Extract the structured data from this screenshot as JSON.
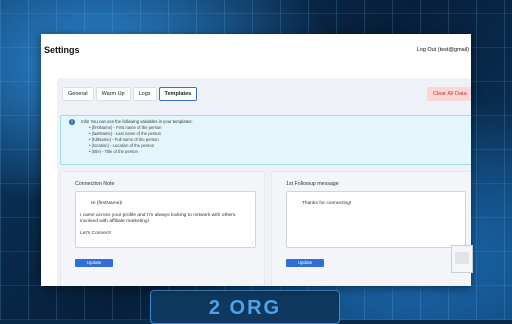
{
  "page": {
    "title": "Settings",
    "logout": "Log Out (test@gmail)"
  },
  "tabs": [
    "General",
    "Warm Up",
    "Logs",
    "Templates"
  ],
  "active_tab": "Templates",
  "clear_button": "Clear All Data",
  "info": {
    "icon": "info-icon",
    "title": "Info! You can use the following variables in your templates:",
    "items": [
      "{firstName} - First name of the person",
      "{lastName} - Last name of the person",
      "{fullName} - Full name of the person",
      "{location} - Location of the person",
      "{title} - Title of the person"
    ]
  },
  "connection": {
    "label": "Connection Note",
    "value": "Hi {firstName}!\n\nI came across your profile and I'm always looking to network with others involved with affiliate marketing!\n\nLet's Connect!",
    "button": "Update"
  },
  "followup": {
    "label": "1st Followup message",
    "value": "Thanks for connecting!",
    "button": "Update"
  },
  "background": {
    "chip_text": "2 ORG"
  },
  "colors": {
    "accent": "#2f6fd6",
    "danger_bg": "#fbd7d7",
    "info_bg": "#e3f6fb"
  }
}
